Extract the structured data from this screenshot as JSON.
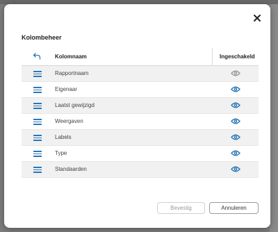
{
  "dialog": {
    "title": "Kolombeheer",
    "close_icon": "close-icon"
  },
  "table": {
    "header_back_icon": "undo-icon",
    "header_name": "Kolomnaam",
    "header_enabled": "Ingeschakeld",
    "rows": [
      {
        "label": "Rapportnaam",
        "enabled": false
      },
      {
        "label": "Eigenaar",
        "enabled": true
      },
      {
        "label": "Laatst gewijzigd",
        "enabled": true
      },
      {
        "label": "Weergaven",
        "enabled": true
      },
      {
        "label": "Labels",
        "enabled": true
      },
      {
        "label": "Type",
        "enabled": true
      },
      {
        "label": "Standaarden",
        "enabled": true
      }
    ]
  },
  "buttons": {
    "confirm": "Bevestig",
    "cancel": "Annuleren"
  },
  "colors": {
    "accent": "#2a78b8",
    "disabled_eye": "#9a9a9a"
  }
}
